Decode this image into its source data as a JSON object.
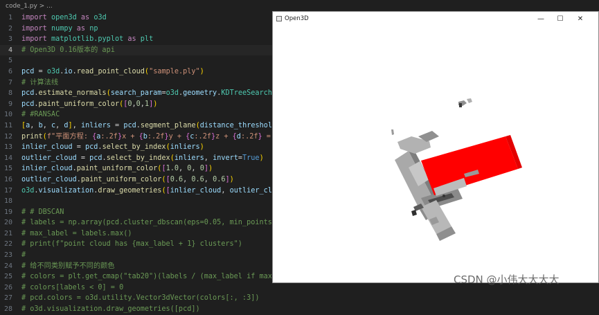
{
  "editor": {
    "breadcrumb": "code_1.py > ...",
    "current_line": 4
  },
  "open3d": {
    "title": "Open3D",
    "minimize": "—",
    "maximize": "☐",
    "close": "✕"
  },
  "watermark": "CSDN @小伟大大大大",
  "colors": {
    "inlier_plane": "#ff0000",
    "outlier_cloud": "#999999",
    "editor_bg": "#1f1f1f"
  }
}
